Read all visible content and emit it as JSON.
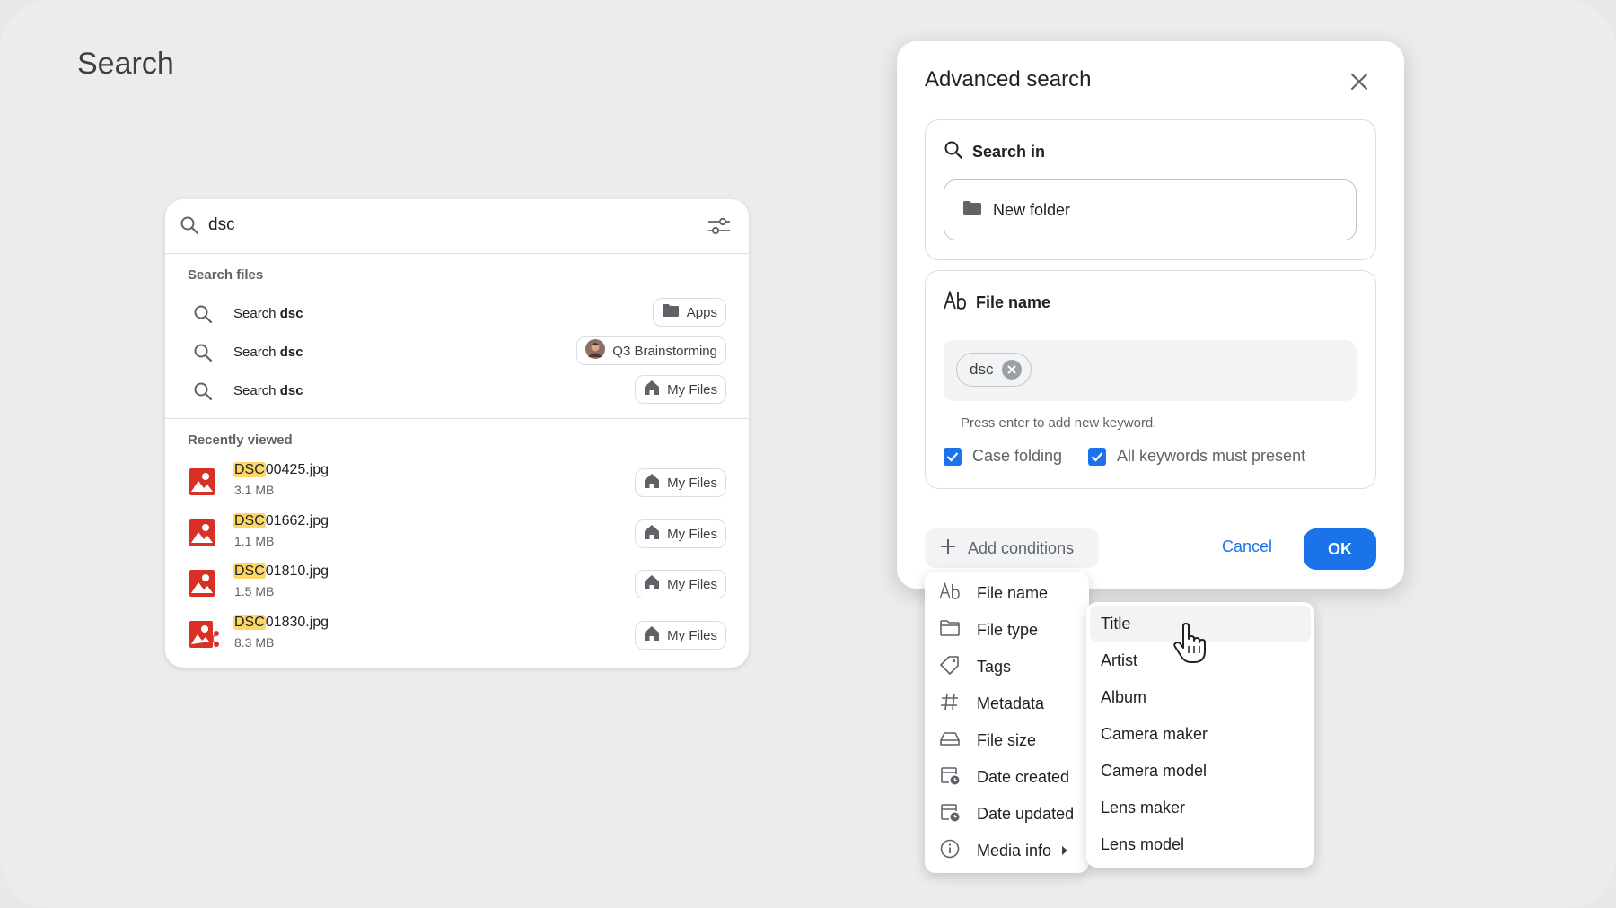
{
  "page": {
    "title": "Search"
  },
  "search": {
    "query": "dsc",
    "section_search_files": "Search files",
    "suggestions": [
      {
        "prefix": "Search ",
        "term": "dsc",
        "location": "Apps",
        "location_icon": "folder-icon"
      },
      {
        "prefix": "Search ",
        "term": "dsc",
        "location": "Q3 Brainstorming",
        "location_icon": "avatar"
      },
      {
        "prefix": "Search ",
        "term": "dsc",
        "location": "My Files",
        "location_icon": "home-icon"
      }
    ],
    "section_recent": "Recently viewed",
    "recent": [
      {
        "highlight": "DSC",
        "rest": "00425.jpg",
        "size": "3.1 MB",
        "location": "My Files",
        "icon": "image-file-icon"
      },
      {
        "highlight": "DSC",
        "rest": "01662.jpg",
        "size": "1.1 MB",
        "location": "My Files",
        "icon": "image-file-icon"
      },
      {
        "highlight": "DSC",
        "rest": "01810.jpg",
        "size": "1.5 MB",
        "location": "My Files",
        "icon": "image-file-icon"
      },
      {
        "highlight": "DSC",
        "rest": "01830.jpg",
        "size": "8.3 MB",
        "location": "My Files",
        "icon": "shared-image-file-icon"
      }
    ]
  },
  "dialog": {
    "title": "Advanced search",
    "search_in": {
      "label": "Search in",
      "folder": "New folder"
    },
    "file_name": {
      "label": "File name",
      "keyword": "dsc",
      "hint": "Press enter to add new keyword.",
      "case_folding": "Case folding",
      "case_folding_checked": true,
      "all_keywords": "All keywords must present",
      "all_keywords_checked": true
    },
    "add_conditions": "Add conditions",
    "cancel": "Cancel",
    "ok": "OK"
  },
  "conditions_menu": [
    {
      "label": "File name",
      "icon": "text-ab-icon"
    },
    {
      "label": "File type",
      "icon": "folder-outline-icon"
    },
    {
      "label": "Tags",
      "icon": "tag-icon"
    },
    {
      "label": "Metadata",
      "icon": "hash-icon"
    },
    {
      "label": "File size",
      "icon": "drive-icon"
    },
    {
      "label": "Date created",
      "icon": "calendar-clock-icon"
    },
    {
      "label": "Date updated",
      "icon": "calendar-clock-icon"
    },
    {
      "label": "Media info",
      "icon": "info-icon"
    }
  ],
  "media_info_menu": [
    "Title",
    "Artist",
    "Album",
    "Camera maker",
    "Camera model",
    "Lens maker",
    "Lens model"
  ],
  "colors": {
    "accent": "#1a73e8",
    "highlight": "#fdd663",
    "file_icon": "#d93025"
  }
}
